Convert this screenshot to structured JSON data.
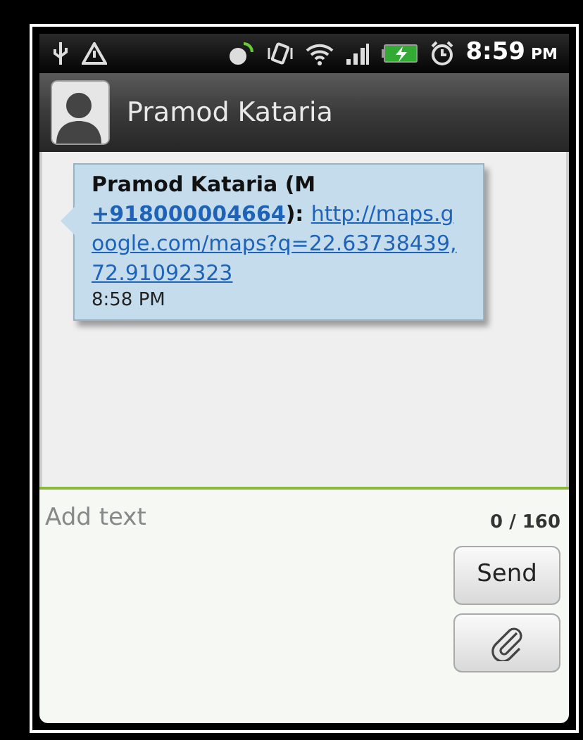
{
  "status_bar": {
    "time": "8:59",
    "meridiem": "PM"
  },
  "header": {
    "contact_name": "Pramod Kataria"
  },
  "messages": [
    {
      "sender": "Pramod Kataria (M",
      "phone": "+918000004664",
      "separator": "):",
      "url": "http://maps.google.com/maps?q=22.63738439,72.91092323",
      "time": "8:58 PM"
    }
  ],
  "compose": {
    "placeholder": "Add text",
    "counter": "0 / 160",
    "send_label": "Send"
  }
}
